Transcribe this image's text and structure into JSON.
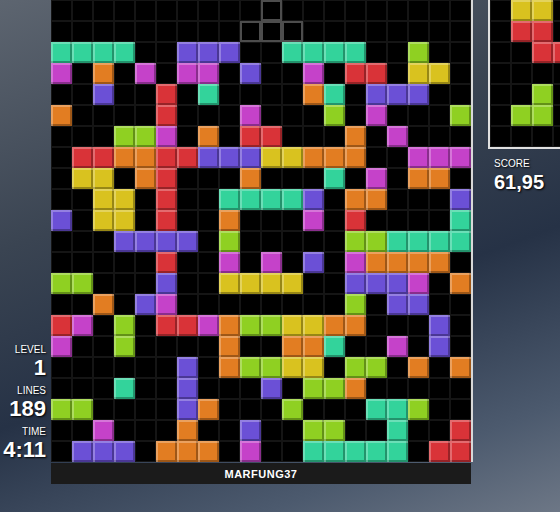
{
  "palette": {
    "T": {
      "color": "#33d39b",
      "kind": "block"
    },
    "P": {
      "color": "#6b50d6",
      "kind": "block"
    },
    "M": {
      "color": "#c542c9",
      "kind": "block"
    },
    "O": {
      "color": "#e27d22",
      "kind": "block"
    },
    "R": {
      "color": "#d93338",
      "kind": "block"
    },
    "Y": {
      "color": "#d9c21f",
      "kind": "block"
    },
    "G": {
      "color": "#8fd022",
      "kind": "block"
    },
    "g": {
      "color": "#4d4d4d",
      "kind": "ghost"
    }
  },
  "board": {
    "rows": [
      "..........g.........",
      ".........ggg........",
      "TTTT..PPP..TTTT..G..",
      "M.O.M.MM.P..M.RR.YY.",
      "..P..R.T....OT.PPP..",
      "O....R...M...G.M...G",
      "...GGM.O.RR...O.M...",
      ".RROORRPPPYYOOO..MMM",
      ".YY.OR...O...T.M.OO.",
      "..YY.R..TTTTP.OO...P",
      "P.YY.R..O...M.R....T",
      "...PPPP.G.....GGTTTT",
      ".....R..M.M.P.MOOOO.",
      "GG...P..YYYY..PPPM.O",
      "..O.PM........G.PP..",
      "RM.G.RRMOGGYYOO...P.",
      "M..G....O..OOT..M.P.",
      "......P.OGGYY.GG.O.O",
      "...T..P...P.GGO.....",
      "GG....PO...G...TTG..",
      "..M...O..P..GG..T..R",
      ".PPP.OOO.M..TTTTT.RR"
    ]
  },
  "next": {
    "rows": [
      ".YY.",
      ".RR.",
      "..RR",
      "....",
      "..G.",
      ".GG.",
      "...."
    ]
  },
  "score": {
    "label": "SCORE",
    "value": "61,95"
  },
  "stats": [
    {
      "label": "LEVEL",
      "value": "1"
    },
    {
      "label": "LINES",
      "value": "189"
    },
    {
      "label": "TIME",
      "value": "4:11"
    }
  ],
  "player": {
    "name": "MARFUNG37"
  }
}
